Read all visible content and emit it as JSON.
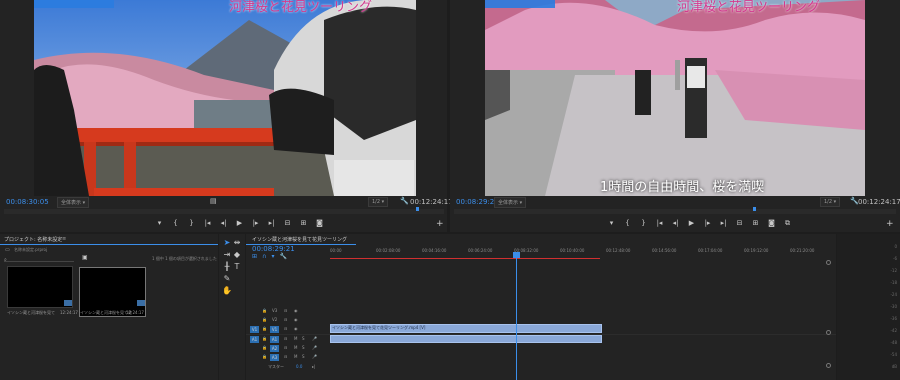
{
  "source_monitor": {
    "title_overlay": "河津桜と花見ツーリング",
    "timecode": "00:08:30:05",
    "fit_label": "全体表示",
    "fraction": "1/2",
    "duration": "00:12:24:17"
  },
  "program_monitor": {
    "title_overlay": "河津桜と花見ツーリング",
    "subtitle": "1時間の自由時間、桜を満喫",
    "timecode": "00:08:29:21",
    "fit_label": "全体表示",
    "fraction": "1/2",
    "duration": "00:12:24:17"
  },
  "project_panel": {
    "tab_label": "プロジェクト: 名称未設定",
    "search_placeholder": "",
    "info_text": "1 個中 1 個の項目が選択されました",
    "sub_label": "名称未設定.prproj",
    "items": [
      {
        "name": "イソシン蔵と河津桜を見て",
        "duration": "12:24:17"
      },
      {
        "name": "イソシン蔵と河津桜を見て花",
        "duration": "12:24:17"
      }
    ]
  },
  "timeline": {
    "sequence_name": "イソシン蔵と河津桜を見て花見ツーリング",
    "timecode": "00:08:29:21",
    "ruler_ticks": [
      "00:00",
      "00:02:08:00",
      "00:04:16:00",
      "00:06:24:00",
      "00:08:32:00",
      "00:10:40:00",
      "00:12:48:00",
      "00:14:56:00",
      "00:17:04:00",
      "00:19:12:00",
      "00:21:20:00"
    ],
    "tracks": [
      {
        "id": "V3"
      },
      {
        "id": "V2"
      },
      {
        "id": "V1",
        "src": "V1"
      },
      {
        "id": "A1",
        "src": "A1"
      },
      {
        "id": "A2"
      },
      {
        "id": "A3"
      }
    ],
    "master_label": "マスター",
    "master_value": "0.0",
    "clip_label": "イソシン蔵と河津桜を見て花見ツーリング.mp4 [V]"
  },
  "meter": {
    "ticks": [
      "0",
      "-6",
      "-12",
      "-18",
      "-24",
      "-30",
      "-36",
      "-42",
      "-48",
      "-54",
      "dB"
    ]
  },
  "colors": {
    "accent": "#3b8eea",
    "clip": "#8aa8d8",
    "in_out": "#d03030"
  }
}
